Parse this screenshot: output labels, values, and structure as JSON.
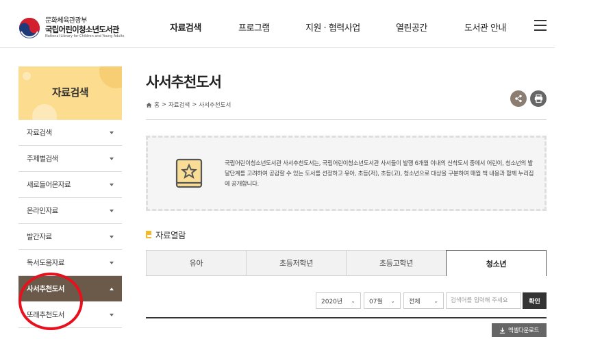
{
  "header": {
    "ministry": "문화체육관광부",
    "library_name": "국립어린이청소년도서관",
    "library_eng": "National Library for Children and Young Adults",
    "nav": [
      {
        "label": "자료검색",
        "active": true
      },
      {
        "label": "프로그램",
        "active": false
      },
      {
        "label": "지원 · 협력사업",
        "active": false
      },
      {
        "label": "열린공간",
        "active": false
      },
      {
        "label": "도서관 안내",
        "active": false
      }
    ]
  },
  "sidebar": {
    "title": "자료검색",
    "items": [
      {
        "label": "자료검색"
      },
      {
        "label": "주제별검색"
      },
      {
        "label": "새로들어온자료"
      },
      {
        "label": "온라인자료"
      },
      {
        "label": "발간자료"
      },
      {
        "label": "독서도움자료"
      },
      {
        "label": "사서추천도서"
      },
      {
        "label": "또래추천도서"
      }
    ]
  },
  "main": {
    "title": "사서추천도서",
    "breadcrumb": {
      "home": "홈",
      "sep": ">",
      "level1": "자료검색",
      "level2": "사서추천도서"
    },
    "info": "국립어린이청소년도서관 사서추천도서는, 국립어린이청소년도서관 사서들이 발행 6개월 이내의 신착도서 중에서 어린이, 청소년의 발달단계를 고려하여 공감할 수 있는 도서를 선정하고 유아, 초등(저), 초등(고), 청소년으로 대상을 구분하여 매월 책 내용과 함께 누리집에 공개합니다.",
    "section_title": "자료열람",
    "tabs": [
      {
        "label": "유아",
        "active": false
      },
      {
        "label": "초등저학년",
        "active": false
      },
      {
        "label": "초등고학년",
        "active": false
      },
      {
        "label": "청소년",
        "active": true
      }
    ],
    "filters": {
      "year": "2020년",
      "month": "07월",
      "scope": "전체",
      "search_placeholder": "검색어를 입력해 주세요",
      "confirm_label": "확인"
    },
    "excel_label": "엑셀다운로드"
  },
  "colors": {
    "accent_yellow": "#fcdc8e",
    "sidebar_active": "#6b5a4a",
    "highlight_circle": "#e8101c"
  }
}
